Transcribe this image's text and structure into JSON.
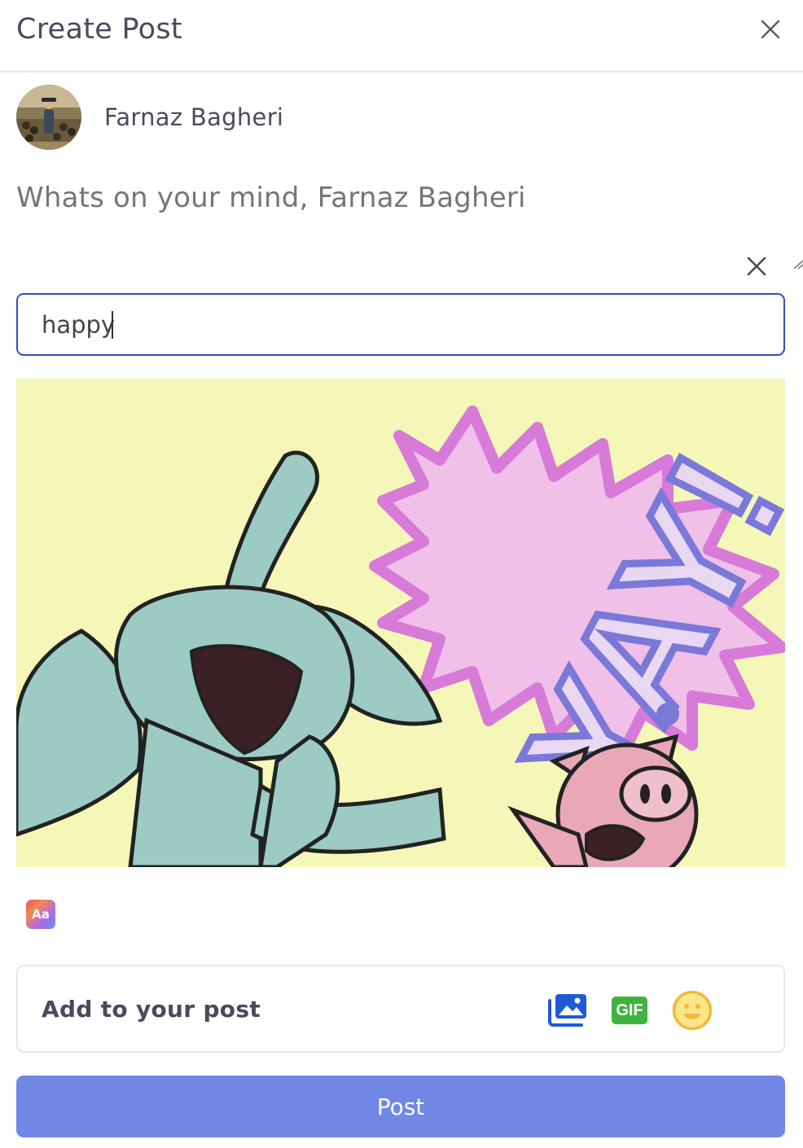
{
  "header": {
    "title": "Create Post"
  },
  "user": {
    "name": "Farnaz Bagheri"
  },
  "composer": {
    "placeholder": "Whats on your mind, Farnaz Bagheri",
    "value": ""
  },
  "gif_search": {
    "value": "happy"
  },
  "gif_result": {
    "caption": "YAY!"
  },
  "font_toggle": {
    "label": "Aa"
  },
  "add_to_post": {
    "label": "Add to your post",
    "icons": [
      "photo-gallery-icon",
      "gif-icon",
      "emoji-icon"
    ],
    "gif_label": "GIF"
  },
  "post_button": {
    "label": "Post"
  },
  "colors": {
    "accent": "#7087e6",
    "focus_border": "#2f4fc4",
    "gif_green": "#3fb33f",
    "photo_blue": "#1f5ad6",
    "emoji_yellow": "#f3b73a"
  }
}
